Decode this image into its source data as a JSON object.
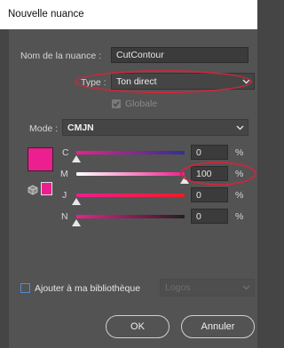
{
  "window": {
    "title": "Nouvelle nuance"
  },
  "form": {
    "swatch_name_label": "Nom de la nuance :",
    "swatch_name_value": "CutContour",
    "type_label": "Type :",
    "type_value": "Ton direct",
    "global_label": "Globale",
    "global_checked": true,
    "mode_label": "Mode :",
    "mode_value": "CMJN"
  },
  "color": {
    "swatch_hex": "#ed1e8f",
    "channels": [
      {
        "letter": "C",
        "value": "0",
        "unit": "%",
        "fraction": 0
      },
      {
        "letter": "M",
        "value": "100",
        "unit": "%",
        "fraction": 1
      },
      {
        "letter": "J",
        "value": "0",
        "unit": "%",
        "fraction": 0
      },
      {
        "letter": "N",
        "value": "0",
        "unit": "%",
        "fraction": 0
      }
    ]
  },
  "library": {
    "add_label": "Ajouter à ma bibliothèque",
    "add_checked": false,
    "library_value": "Logos"
  },
  "buttons": {
    "ok": "OK",
    "cancel": "Annuler"
  },
  "colors": {
    "highlight": "#c8283c",
    "panel": "#535353"
  }
}
